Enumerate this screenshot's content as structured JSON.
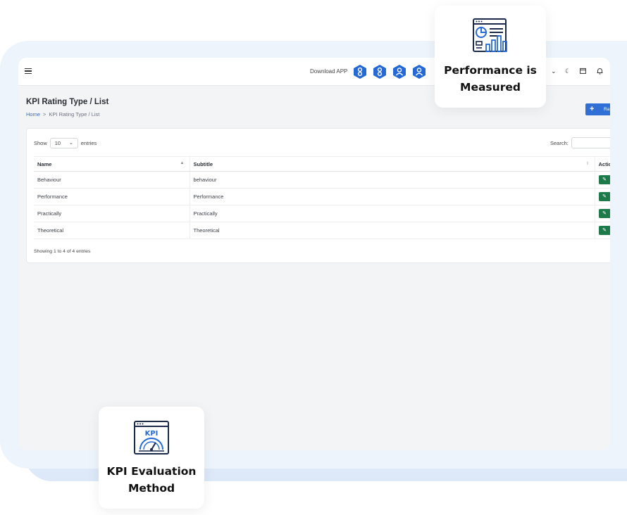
{
  "topbar": {
    "download_label": "Download APP",
    "app_icons": [
      "play-store-icon",
      "play-store-icon",
      "app-store-icon",
      "app-store-icon"
    ],
    "right_icons": [
      "chevron-down-icon",
      "moon-icon",
      "calendar-icon",
      "bell-icon"
    ]
  },
  "page": {
    "title": "KPI Rating Type / List",
    "breadcrumb_home": "Home",
    "breadcrumb_sep": ">",
    "breadcrumb_current": "KPI Rating Type / List"
  },
  "add_button": {
    "label": "Ra"
  },
  "table_controls": {
    "show_label": "Show",
    "page_size": "10",
    "entries_label": "entries",
    "search_label": "Search:"
  },
  "table": {
    "columns": [
      "Name",
      "Subtitle",
      "Actio"
    ],
    "rows": [
      {
        "name": "Behaviour",
        "subtitle": "behaviour"
      },
      {
        "name": "Performance",
        "subtitle": "Performance"
      },
      {
        "name": "Practically",
        "subtitle": "Practically"
      },
      {
        "name": "Theoretical",
        "subtitle": "Theoretical"
      }
    ],
    "info": "Showing 1 to 4 of 4 entries"
  },
  "features": {
    "performance": {
      "line1": "Performance is",
      "line2": "Measured"
    },
    "kpi": {
      "line1": "KPI Evaluation",
      "line2": "Method",
      "icon_text": "KPI"
    }
  },
  "colors": {
    "accent": "#3070d6",
    "edit_button": "#1f7a4a",
    "background_panel": "#eef4fc",
    "icon_blue": "#2469d6"
  }
}
